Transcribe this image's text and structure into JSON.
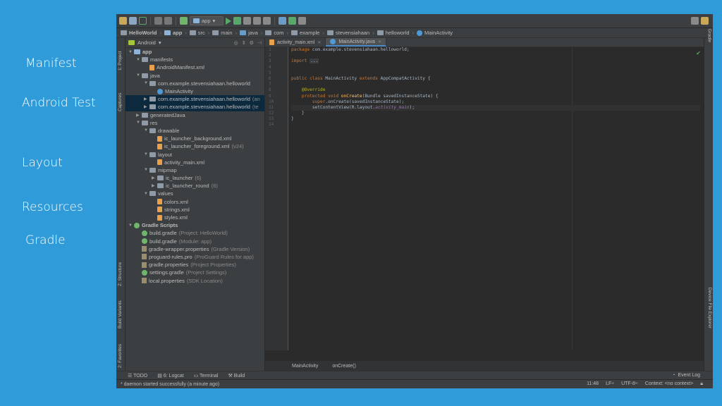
{
  "slide_labels": {
    "manifest": "Manifest",
    "android_test": "Android Test",
    "layout": "Layout",
    "resources": "Resources",
    "gradle": "Gradle"
  },
  "toolbar": {
    "run_config": "app"
  },
  "breadcrumb": [
    "HelloWorld",
    "app",
    "src",
    "main",
    "java",
    "com",
    "example",
    "stevensiahaan",
    "helloworld",
    "MainActivity"
  ],
  "project_panel": {
    "view_mode": "Android"
  },
  "tree": [
    {
      "label": "app",
      "extra": "",
      "indent": 0,
      "arrow": "▼",
      "icon": "mod-ico"
    },
    {
      "label": "manifests",
      "extra": "",
      "indent": 1,
      "arrow": "▼",
      "icon": "folder"
    },
    {
      "label": "AndroidManifest.xml",
      "extra": "",
      "indent": 2,
      "arrow": "",
      "icon": "xml-ico"
    },
    {
      "label": "java",
      "extra": "",
      "indent": 1,
      "arrow": "▼",
      "icon": "folder"
    },
    {
      "label": "com.example.stevensiahaan.helloworld",
      "extra": "",
      "indent": 2,
      "arrow": "▼",
      "icon": "folder"
    },
    {
      "label": "MainActivity",
      "extra": "",
      "indent": 3,
      "arrow": "",
      "icon": "java-c"
    },
    {
      "label": "com.example.stevensiahaan.helloworld",
      "extra": "(an",
      "indent": 2,
      "arrow": "▶",
      "icon": "folder"
    },
    {
      "label": "com.example.stevensiahaan.helloworld",
      "extra": "(te",
      "indent": 2,
      "arrow": "▶",
      "icon": "folder"
    },
    {
      "label": "generatedJava",
      "extra": "",
      "indent": 1,
      "arrow": "▶",
      "icon": "folder"
    },
    {
      "label": "res",
      "extra": "",
      "indent": 1,
      "arrow": "▼",
      "icon": "folder"
    },
    {
      "label": "drawable",
      "extra": "",
      "indent": 2,
      "arrow": "▼",
      "icon": "folder"
    },
    {
      "label": "ic_launcher_background.xml",
      "extra": "",
      "indent": 3,
      "arrow": "",
      "icon": "xml-ico"
    },
    {
      "label": "ic_launcher_foreground.xml",
      "extra": "(v24)",
      "indent": 3,
      "arrow": "",
      "icon": "xml-ico"
    },
    {
      "label": "layout",
      "extra": "",
      "indent": 2,
      "arrow": "▼",
      "icon": "folder"
    },
    {
      "label": "activity_main.xml",
      "extra": "",
      "indent": 3,
      "arrow": "",
      "icon": "xml-ico"
    },
    {
      "label": "mipmap",
      "extra": "",
      "indent": 2,
      "arrow": "▼",
      "icon": "folder"
    },
    {
      "label": "ic_launcher",
      "extra": "(6)",
      "indent": 3,
      "arrow": "▶",
      "icon": "folder"
    },
    {
      "label": "ic_launcher_round",
      "extra": "(6)",
      "indent": 3,
      "arrow": "▶",
      "icon": "folder"
    },
    {
      "label": "values",
      "extra": "",
      "indent": 2,
      "arrow": "▼",
      "icon": "folder"
    },
    {
      "label": "colors.xml",
      "extra": "",
      "indent": 3,
      "arrow": "",
      "icon": "xml-ico"
    },
    {
      "label": "strings.xml",
      "extra": "",
      "indent": 3,
      "arrow": "",
      "icon": "xml-ico"
    },
    {
      "label": "styles.xml",
      "extra": "",
      "indent": 3,
      "arrow": "",
      "icon": "xml-ico"
    },
    {
      "label": "Gradle Scripts",
      "extra": "",
      "indent": 0,
      "arrow": "▼",
      "icon": "gradle-ico"
    },
    {
      "label": "build.gradle",
      "extra": "(Project: HelloWorld)",
      "indent": 1,
      "arrow": "",
      "icon": "gradle-ico"
    },
    {
      "label": "build.gradle",
      "extra": "(Module: app)",
      "indent": 1,
      "arrow": "",
      "icon": "gradle-ico"
    },
    {
      "label": "gradle-wrapper.properties",
      "extra": "(Gradle Version)",
      "indent": 1,
      "arrow": "",
      "icon": "prop-ico"
    },
    {
      "label": "proguard-rules.pro",
      "extra": "(ProGuard Rules for app)",
      "indent": 1,
      "arrow": "",
      "icon": "prop-ico"
    },
    {
      "label": "gradle.properties",
      "extra": "(Project Properties)",
      "indent": 1,
      "arrow": "",
      "icon": "prop-ico"
    },
    {
      "label": "settings.gradle",
      "extra": "(Project Settings)",
      "indent": 1,
      "arrow": "",
      "icon": "gradle-ico"
    },
    {
      "label": "local.properties",
      "extra": "(SDK Location)",
      "indent": 1,
      "arrow": "",
      "icon": "prop-ico"
    }
  ],
  "editor_tabs": [
    {
      "label": "activity_main.xml",
      "active": false
    },
    {
      "label": "MainActivity.java",
      "active": true
    }
  ],
  "code": {
    "line_numbers": [
      "1",
      "2",
      "3",
      "4",
      "5",
      "6",
      "7",
      "8",
      "9",
      "10",
      "11",
      "12",
      "13",
      "14"
    ],
    "l1_kw": "package",
    "l1_rest": " com.example.stevensiahaan.helloworld;",
    "l3_kw": "import",
    "l3_fold": "...",
    "l6_kw": "public class",
    "l6_name": " MainActivity ",
    "l6_kw2": "extends",
    "l6_rest": " AppCompatActivity {",
    "l8_ann": "@Override",
    "l9_kw": "protected void",
    "l9_fn": " onCreate",
    "l9_rest": "(Bundle savedInstanceState) {",
    "l10_kw": "super",
    "l10_rest": ".onCreate(savedInstanceState);",
    "l11_a": "setContentView(R.layout.",
    "l11_it": "activity_main",
    "l11_b": ");",
    "l12": "}",
    "l13": "}"
  },
  "editor_breadcrumb": [
    "MainActivity",
    "onCreate()"
  ],
  "bottom_tools": {
    "todo": "TODO",
    "logcat": "6: Logcat",
    "terminal": "Terminal",
    "build": "Build",
    "event_log": "Event Log"
  },
  "status_bar": {
    "message": "* daemon started successfully (a minute ago)",
    "position": "11:48",
    "line_sep": "LF÷",
    "encoding": "UTF-8÷",
    "context": "Context: <no context>"
  },
  "side_tabs": {
    "project": "1: Project",
    "captures": "Captures",
    "structure": "Z: Structure",
    "build_variants": "Build Variants",
    "favorites": "2: Favorites",
    "gradle": "Gradle",
    "device_file_explorer": "Device File Explorer"
  },
  "colors": {
    "slide_bg": "#2f9bd9",
    "ide_bg": "#2b2b2b",
    "panel_bg": "#3c3f41",
    "keyword": "#cc7832",
    "annotation": "#bbb529"
  }
}
